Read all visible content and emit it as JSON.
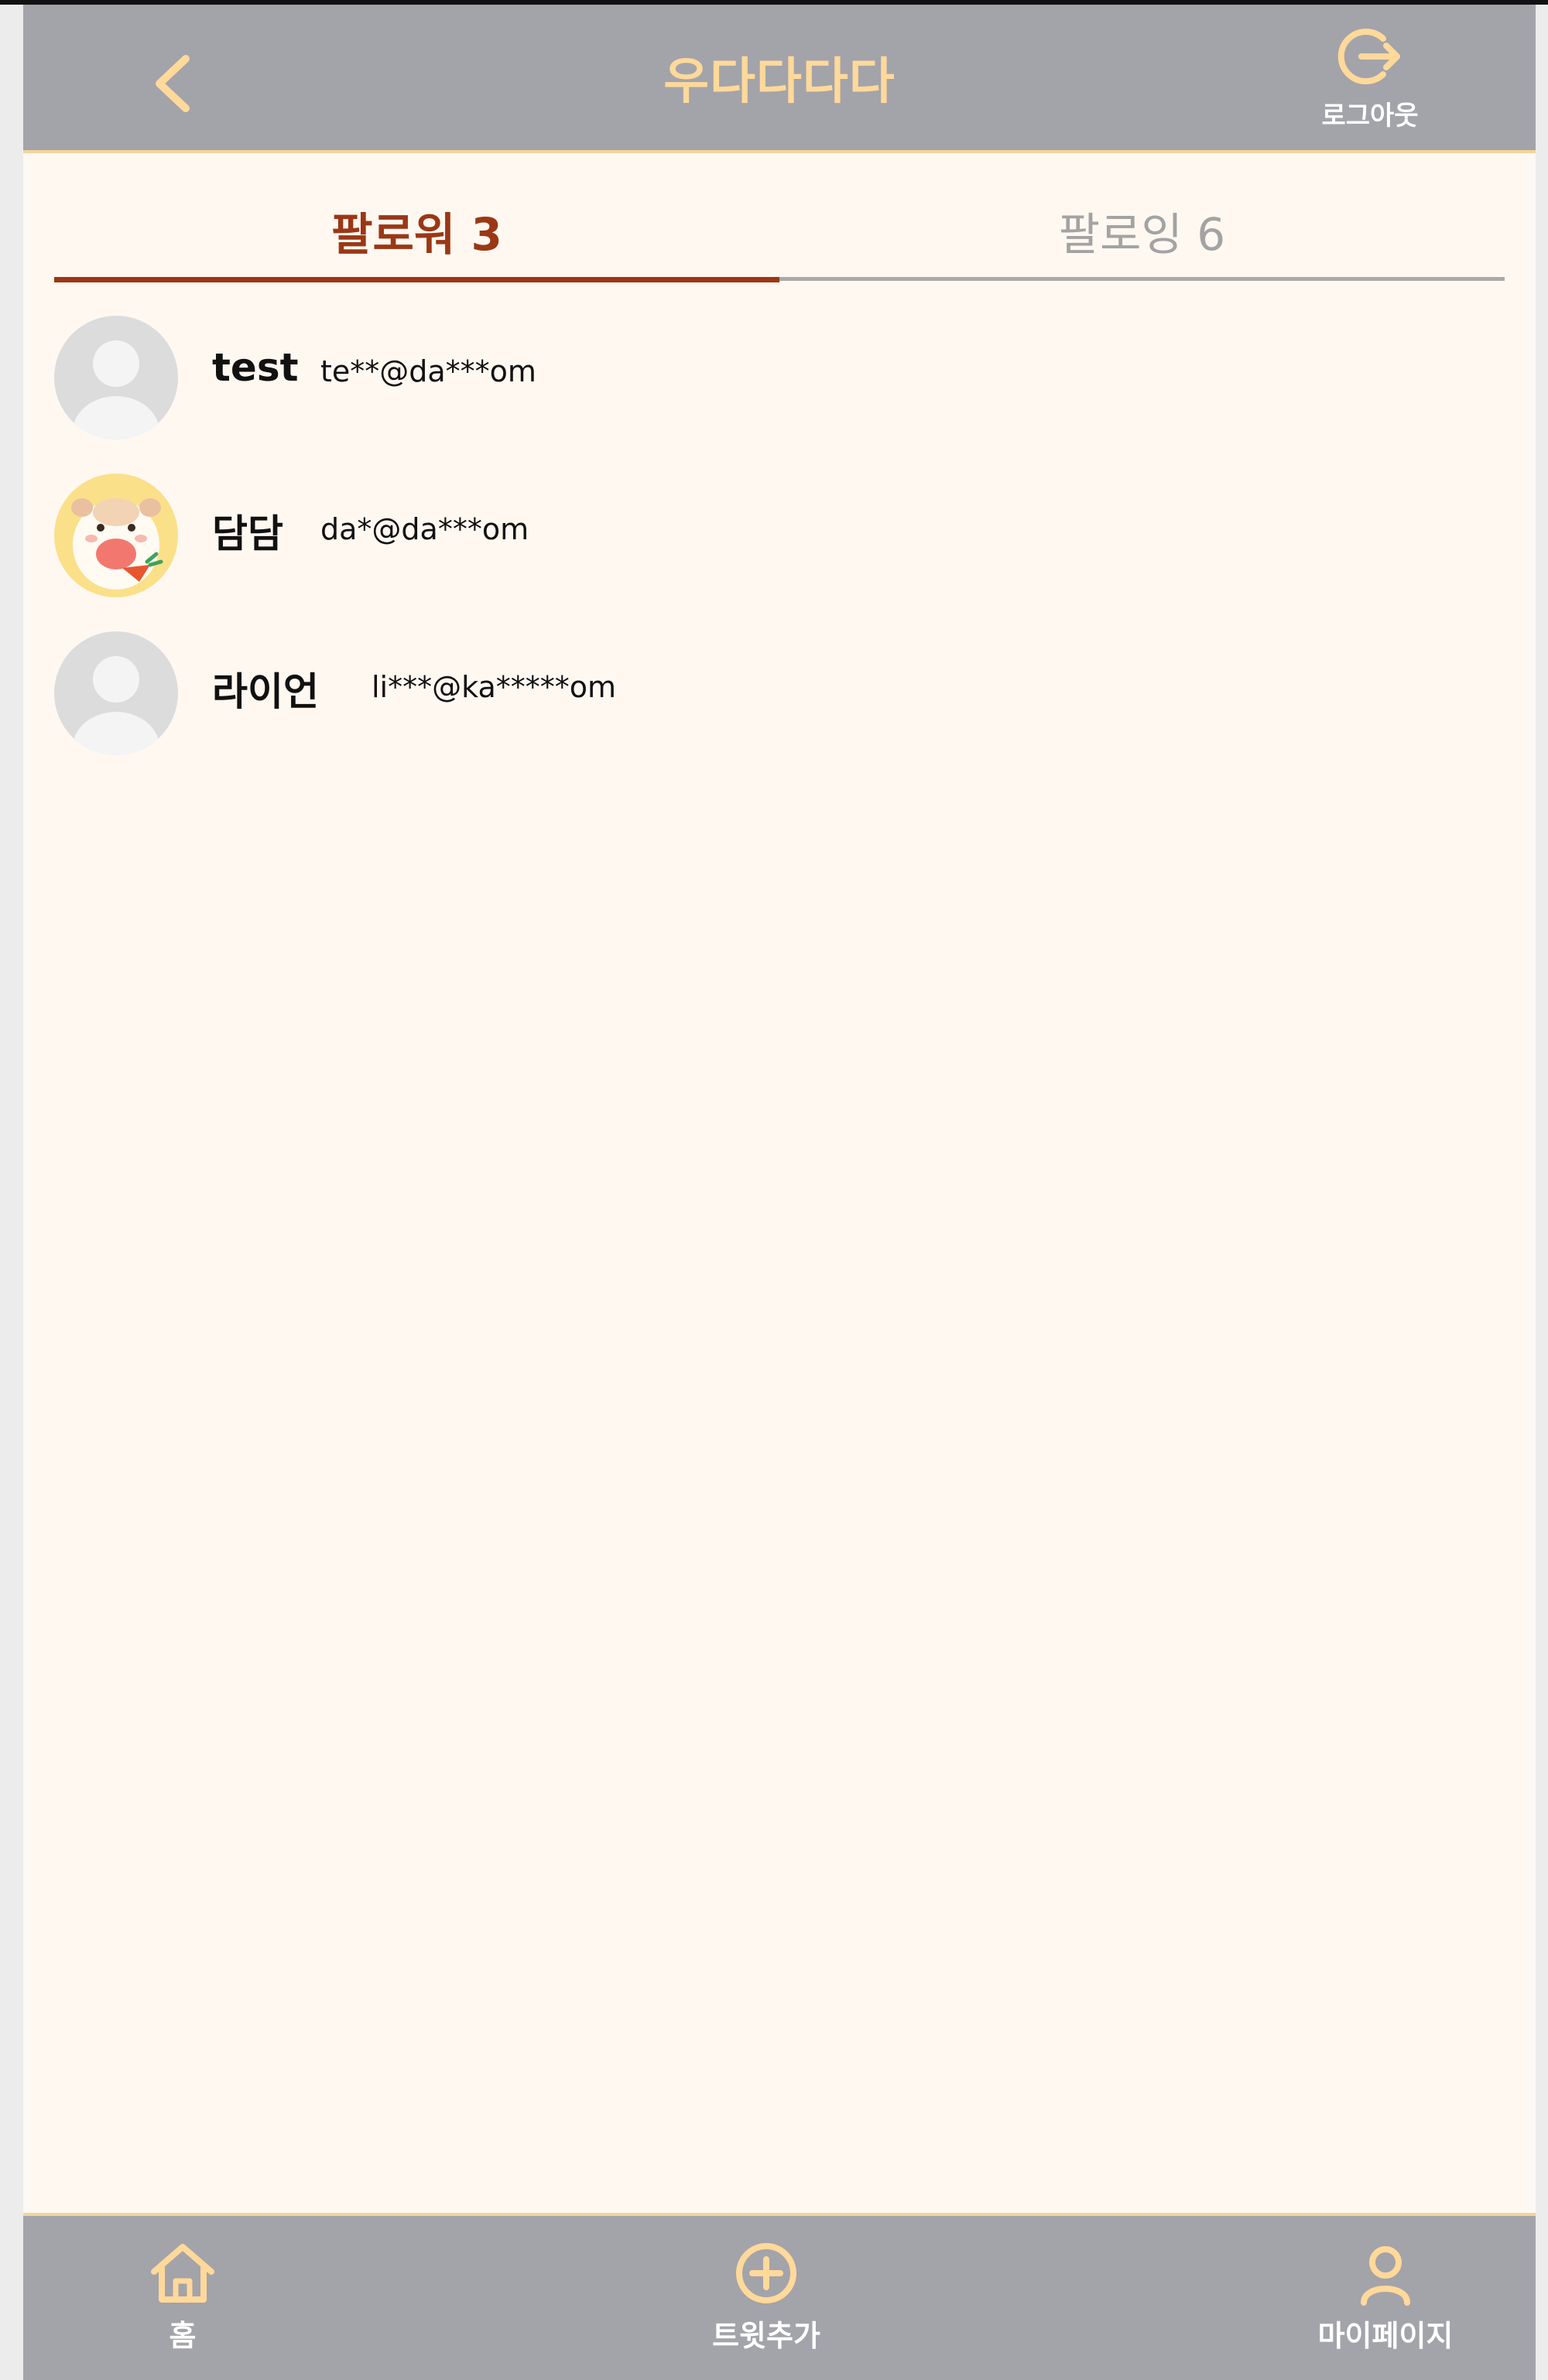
{
  "app": {
    "title": "우다다다다",
    "logout_label": "로그아웃",
    "accent_color": "#ffd99a"
  },
  "tabs": [
    {
      "label": "팔로워 3",
      "active": true
    },
    {
      "label": "팔로잉 6",
      "active": false
    }
  ],
  "followers": [
    {
      "name": "test",
      "email": "te**@da***om",
      "avatar": "default-avatar-icon"
    },
    {
      "name": "담담",
      "email": "da*@da***om",
      "avatar": "hamster-avatar"
    },
    {
      "name": "라이언",
      "email": "li***@ka*****om",
      "avatar": "default-avatar-icon"
    }
  ],
  "bottom_nav": [
    {
      "label": "홈",
      "icon": "home-icon"
    },
    {
      "label": "트윗추가",
      "icon": "plus-circle-icon"
    },
    {
      "label": "마이페이지",
      "icon": "user-icon"
    }
  ]
}
